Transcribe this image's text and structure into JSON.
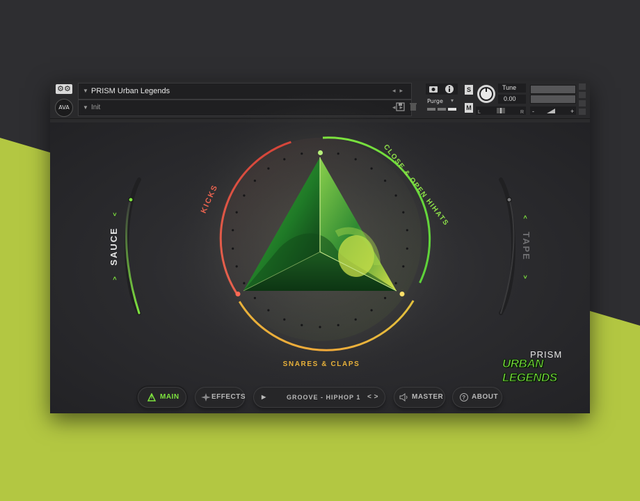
{
  "colors": {
    "accent": "#7ee33e",
    "kicks": "#e8634f",
    "snares": "#e8b13a",
    "hihats": "#7ee33e",
    "background_top": "#2e2e31",
    "background_bottom": "#b3c742"
  },
  "header": {
    "instrument_name": "PRISM Urban Legends",
    "preset_name": "Init",
    "logo_text": "AVA",
    "purge_label": "Purge",
    "solo_label": "S",
    "mute_label": "M",
    "tune_label": "Tune",
    "tune_value": "0.00",
    "pan_left": "L",
    "pan_right": "R",
    "vol_minus": "-",
    "vol_plus": "+"
  },
  "wheel": {
    "kicks_label": "KICKS",
    "hihats_label": "CLOSE & OPEN HIHATS",
    "snares_label": "SNARES & CLAPS"
  },
  "sauce": {
    "label": "SAUCE",
    "left_arrow": "<",
    "right_arrow": ">"
  },
  "tape": {
    "label": "TAPE",
    "left_arrow": "<",
    "right_arrow": ">"
  },
  "footer": {
    "main_label": "MAIN",
    "effects_label": "EFFECTS",
    "groove_label": "GROOVE - HIPHOP 1",
    "groove_nav": "< >",
    "master_label": "MASTER",
    "about_label": "ABOUT"
  },
  "brand": {
    "line1": "PRISM",
    "line2": "URBAN LEGENDS"
  }
}
